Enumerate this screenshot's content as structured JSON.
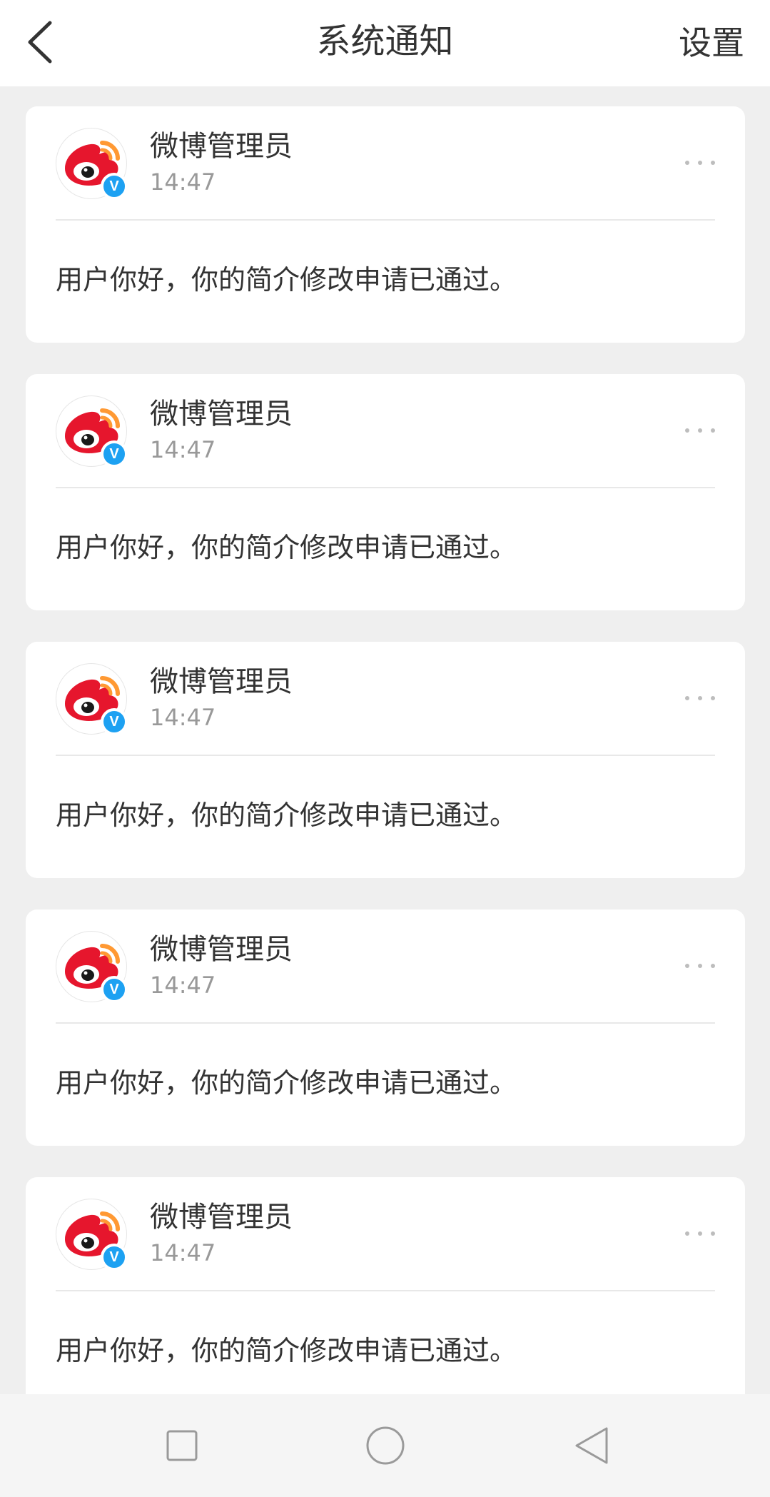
{
  "header": {
    "title": "系统通知",
    "settings_label": "设置",
    "back_icon": "back-arrow-icon"
  },
  "notifications": [
    {
      "sender": "微博管理员",
      "time": "14:47",
      "message": "用户你好，你的简介修改申请已通过。",
      "verified": "V"
    },
    {
      "sender": "微博管理员",
      "time": "14:47",
      "message": "用户你好，你的简介修改申请已通过。",
      "verified": "V"
    },
    {
      "sender": "微博管理员",
      "time": "14:47",
      "message": "用户你好，你的简介修改申请已通过。",
      "verified": "V"
    },
    {
      "sender": "微博管理员",
      "time": "14:47",
      "message": "用户你好，你的简介修改申请已通过。",
      "verified": "V"
    },
    {
      "sender": "微博管理员",
      "time": "14:47",
      "message": "用户你好，你的简介修改申请已通过。",
      "verified": "V"
    }
  ],
  "navbar": {
    "recents_icon": "square-icon",
    "home_icon": "circle-icon",
    "back_icon": "triangle-back-icon"
  },
  "colors": {
    "background": "#efefef",
    "card": "#ffffff",
    "text_primary": "#333333",
    "text_secondary": "#999999",
    "verified_blue": "#1da1f2",
    "weibo_red": "#e6162d",
    "weibo_orange": "#ff9933"
  }
}
